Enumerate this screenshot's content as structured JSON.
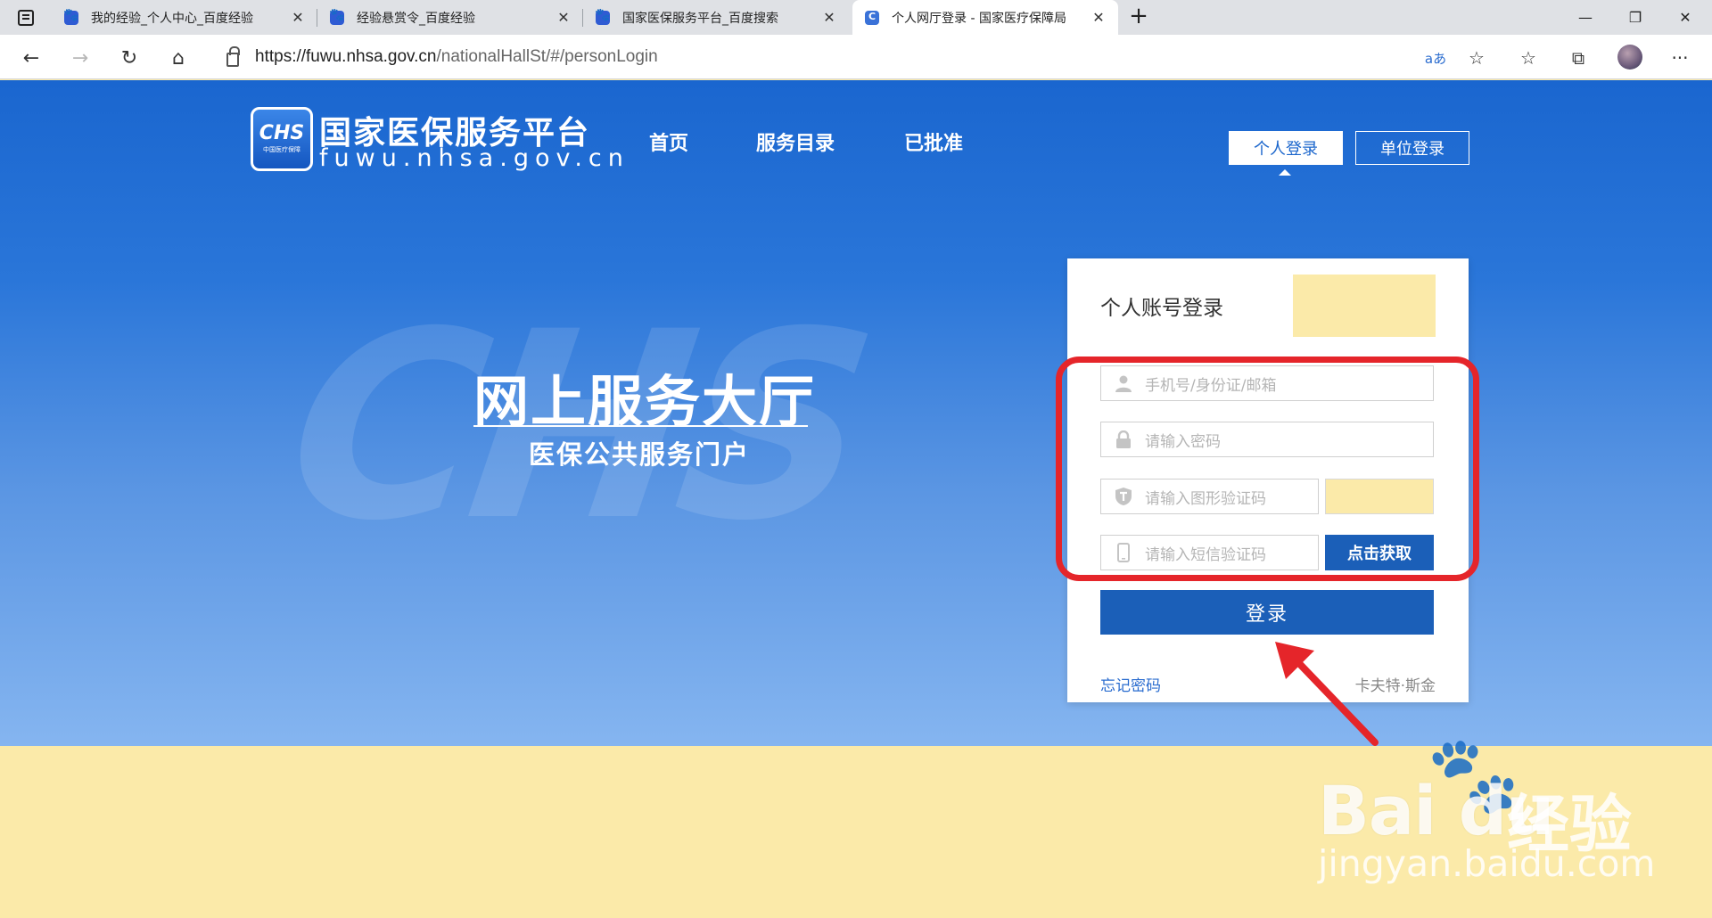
{
  "browser": {
    "tabs": [
      {
        "title": "我的经验_个人中心_百度经验",
        "active": false
      },
      {
        "title": "经验悬赏令_百度经验",
        "active": false
      },
      {
        "title": "国家医保服务平台_百度搜索",
        "active": false
      },
      {
        "title": "个人网厅登录 - 国家医疗保障局",
        "active": true
      }
    ],
    "close_glyph": "✕",
    "new_tab_glyph": "+",
    "window_controls": {
      "minimize": "—",
      "restore": "❐",
      "close": "✕"
    },
    "nav": {
      "back": "←",
      "forward": "→",
      "reload": "↻",
      "home": "⌂"
    },
    "url_host": "https://fuwu.nhsa.gov.cn",
    "url_path": "/nationalHallSt/#/personLogin",
    "icons": {
      "read_aloud": "aあ",
      "favorite": "☆",
      "favorites": "☆",
      "collections": "⧉",
      "more": "···"
    }
  },
  "site": {
    "logo_mark": "CHS",
    "logo_sub": "中国医疗保障",
    "title": "国家医保服务平台",
    "domain": "fuwu.nhsa.gov.cn",
    "nav": [
      "首页",
      "服务目录",
      "已批准"
    ],
    "login_switch": {
      "person": "个人登录",
      "unit": "单位登录"
    },
    "watermark": "CHS",
    "slogan_main": "网上服务大厅",
    "slogan_sub": "医保公共服务门户"
  },
  "login_card": {
    "title": "个人账号登录",
    "account_placeholder": "手机号/身份证/邮箱",
    "password_placeholder": "请输入密码",
    "captcha_placeholder": "请输入图形验证码",
    "sms_placeholder": "请输入短信验证码",
    "sms_button": "点击获取",
    "login_button": "登录",
    "forgot": "忘记密码",
    "register": "卡夫特·斯金"
  },
  "watermark": {
    "brand": "Bai du",
    "jingyan": "经验",
    "domain": "jingyan.baidu.com"
  },
  "colors": {
    "hero_top": "#1a66cf",
    "hero_bottom": "#85b5f0",
    "primary_button": "#1b5fb8",
    "highlight_red": "#e5252a",
    "redaction_yellow": "#fbeaa9"
  }
}
